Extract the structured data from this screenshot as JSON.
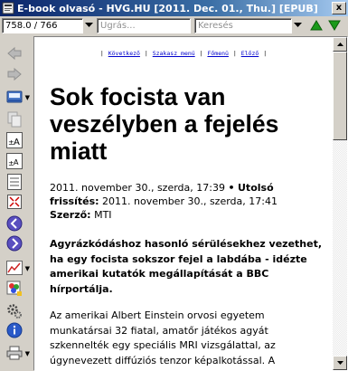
{
  "window": {
    "title": "E-book olvasó - HVG.HU [2011. Dec. 01., Thu.] [EPUB]",
    "close_label": "x"
  },
  "toolbar": {
    "page_position": "758.0 / 766",
    "goto_placeholder": "Ugrás...",
    "search_placeholder": "Keresés"
  },
  "nav_links": {
    "next": "Következő",
    "section_menu": "Szakasz menü",
    "main_menu": "Főmenü",
    "previous": "Előző"
  },
  "article": {
    "headline": "Sok focista van veszélyben a fejelés miatt",
    "date_posted": "2011. november 30., szerda, 17:39",
    "updated_label": "Utolsó frissítés:",
    "date_updated": "2011. november 30., szerda, 17:41",
    "author_label": "Szerző:",
    "author": "MTI",
    "lead": "Agyrázkódáshoz hasonló sérülésekhez vezethet, ha egy focista sokszor fejel a labdába - idézte amerikai kutatók megállapítását a BBC hírportálja.",
    "body": "Az amerikai Albert Einstein orvosi egyetem munkatársai 32 fiatal, amatőr játékos agyát szkennelték egy speciális MRI vizsgálattal, az úgynevezett diffúziós tenzor képalkotással. A"
  },
  "icons": [
    "back-icon",
    "forward-icon",
    "save-icon",
    "copy-icon",
    "font-increase-icon",
    "font-decrease-icon",
    "fit-width-icon",
    "fullscreen-icon",
    "previous-page-icon",
    "next-page-icon",
    "chart-icon",
    "color-scheme-icon",
    "settings-icon",
    "info-icon",
    "print-icon"
  ],
  "colors": {
    "titlebar": "#0a246a",
    "link": "#0000cc",
    "green_arrows": "#1a9a1a",
    "nav_circle": "#5a4fc0"
  }
}
